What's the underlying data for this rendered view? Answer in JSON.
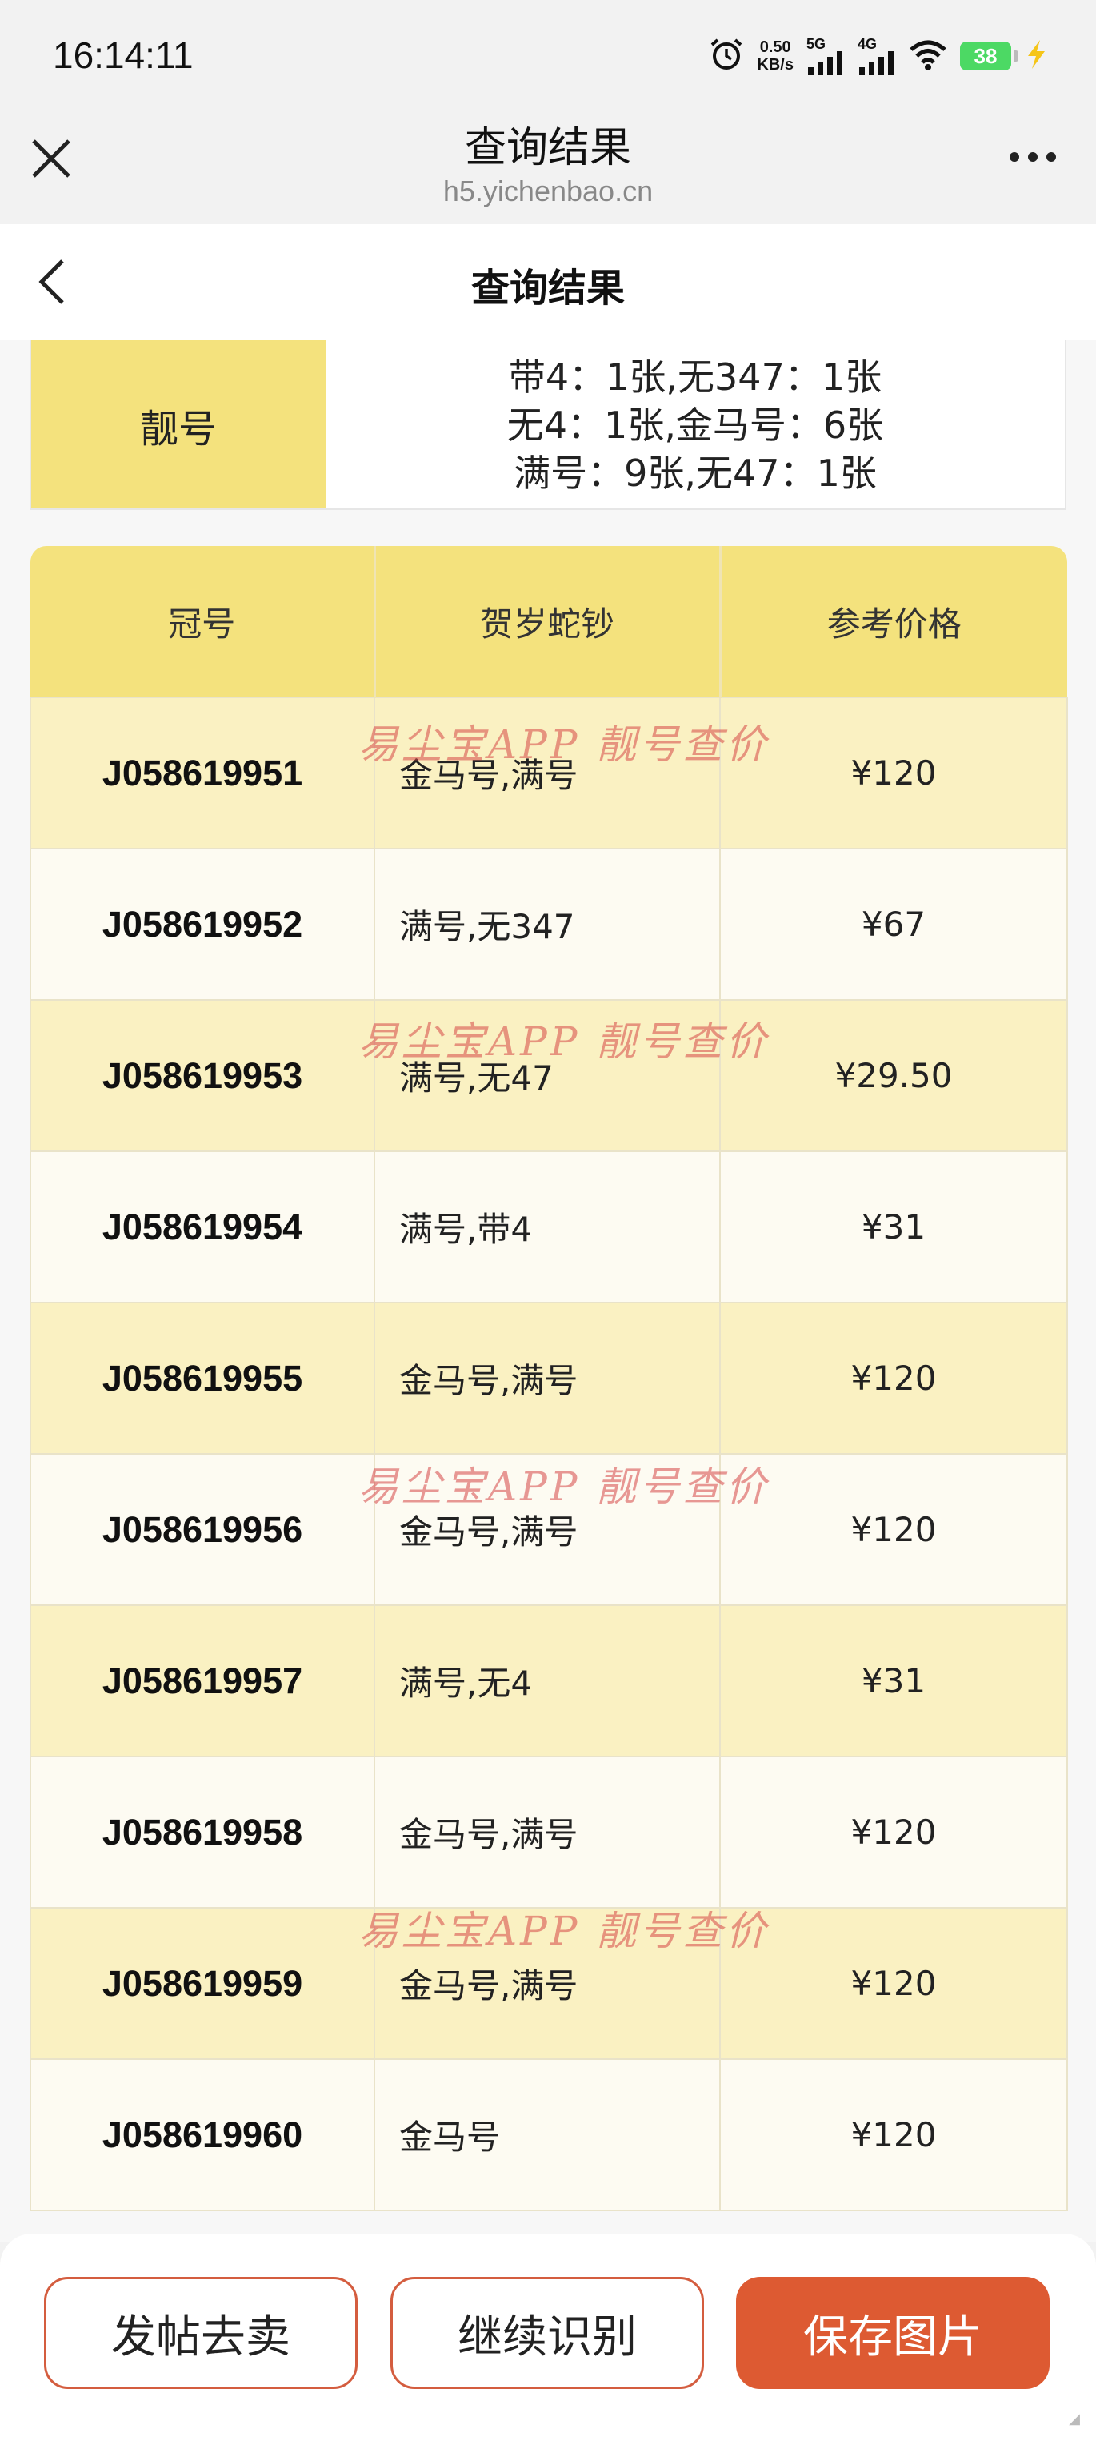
{
  "status_bar": {
    "time": "16:14:11",
    "net_speed_value": "0.50",
    "net_speed_unit": "KB/s",
    "sig1_label": "5G",
    "sig2_label": "4G",
    "battery": "38",
    "icons": [
      "alarm-icon",
      "signal-icon",
      "wifi-icon",
      "battery-icon",
      "charging-icon"
    ]
  },
  "browser": {
    "title": "查询结果",
    "url": "h5.yichenbao.cn"
  },
  "page": {
    "title": "查询结果"
  },
  "summary": {
    "label": "靓号",
    "lines": [
      "带4：1张,无347：1张",
      "无4：1张,金马号：6张",
      "满号：9张,无47：1张"
    ]
  },
  "table": {
    "headers": [
      "冠号",
      "贺岁蛇钞",
      "参考价格"
    ],
    "rows": [
      {
        "serial": "J058619951",
        "tags": "金马号,满号",
        "price": "¥120"
      },
      {
        "serial": "J058619952",
        "tags": "满号,无347",
        "price": "¥67"
      },
      {
        "serial": "J058619953",
        "tags": "满号,无47",
        "price": "¥29.50"
      },
      {
        "serial": "J058619954",
        "tags": "满号,带4",
        "price": "¥31"
      },
      {
        "serial": "J058619955",
        "tags": "金马号,满号",
        "price": "¥120"
      },
      {
        "serial": "J058619956",
        "tags": "金马号,满号",
        "price": "¥120"
      },
      {
        "serial": "J058619957",
        "tags": "满号,无4",
        "price": "¥31"
      },
      {
        "serial": "J058619958",
        "tags": "金马号,满号",
        "price": "¥120"
      },
      {
        "serial": "J058619959",
        "tags": "金马号,满号",
        "price": "¥120"
      },
      {
        "serial": "J058619960",
        "tags": "金马号",
        "price": "¥120"
      }
    ]
  },
  "watermark": "易尘宝APP 靓号查价",
  "actions": {
    "post_sell": "发帖去卖",
    "continue_recognize": "继续识别",
    "save_image": "保存图片"
  },
  "colors": {
    "header_yellow": "#f4e27d",
    "row_yellow": "#faf1c2",
    "accent_orange": "#dd5a32"
  }
}
